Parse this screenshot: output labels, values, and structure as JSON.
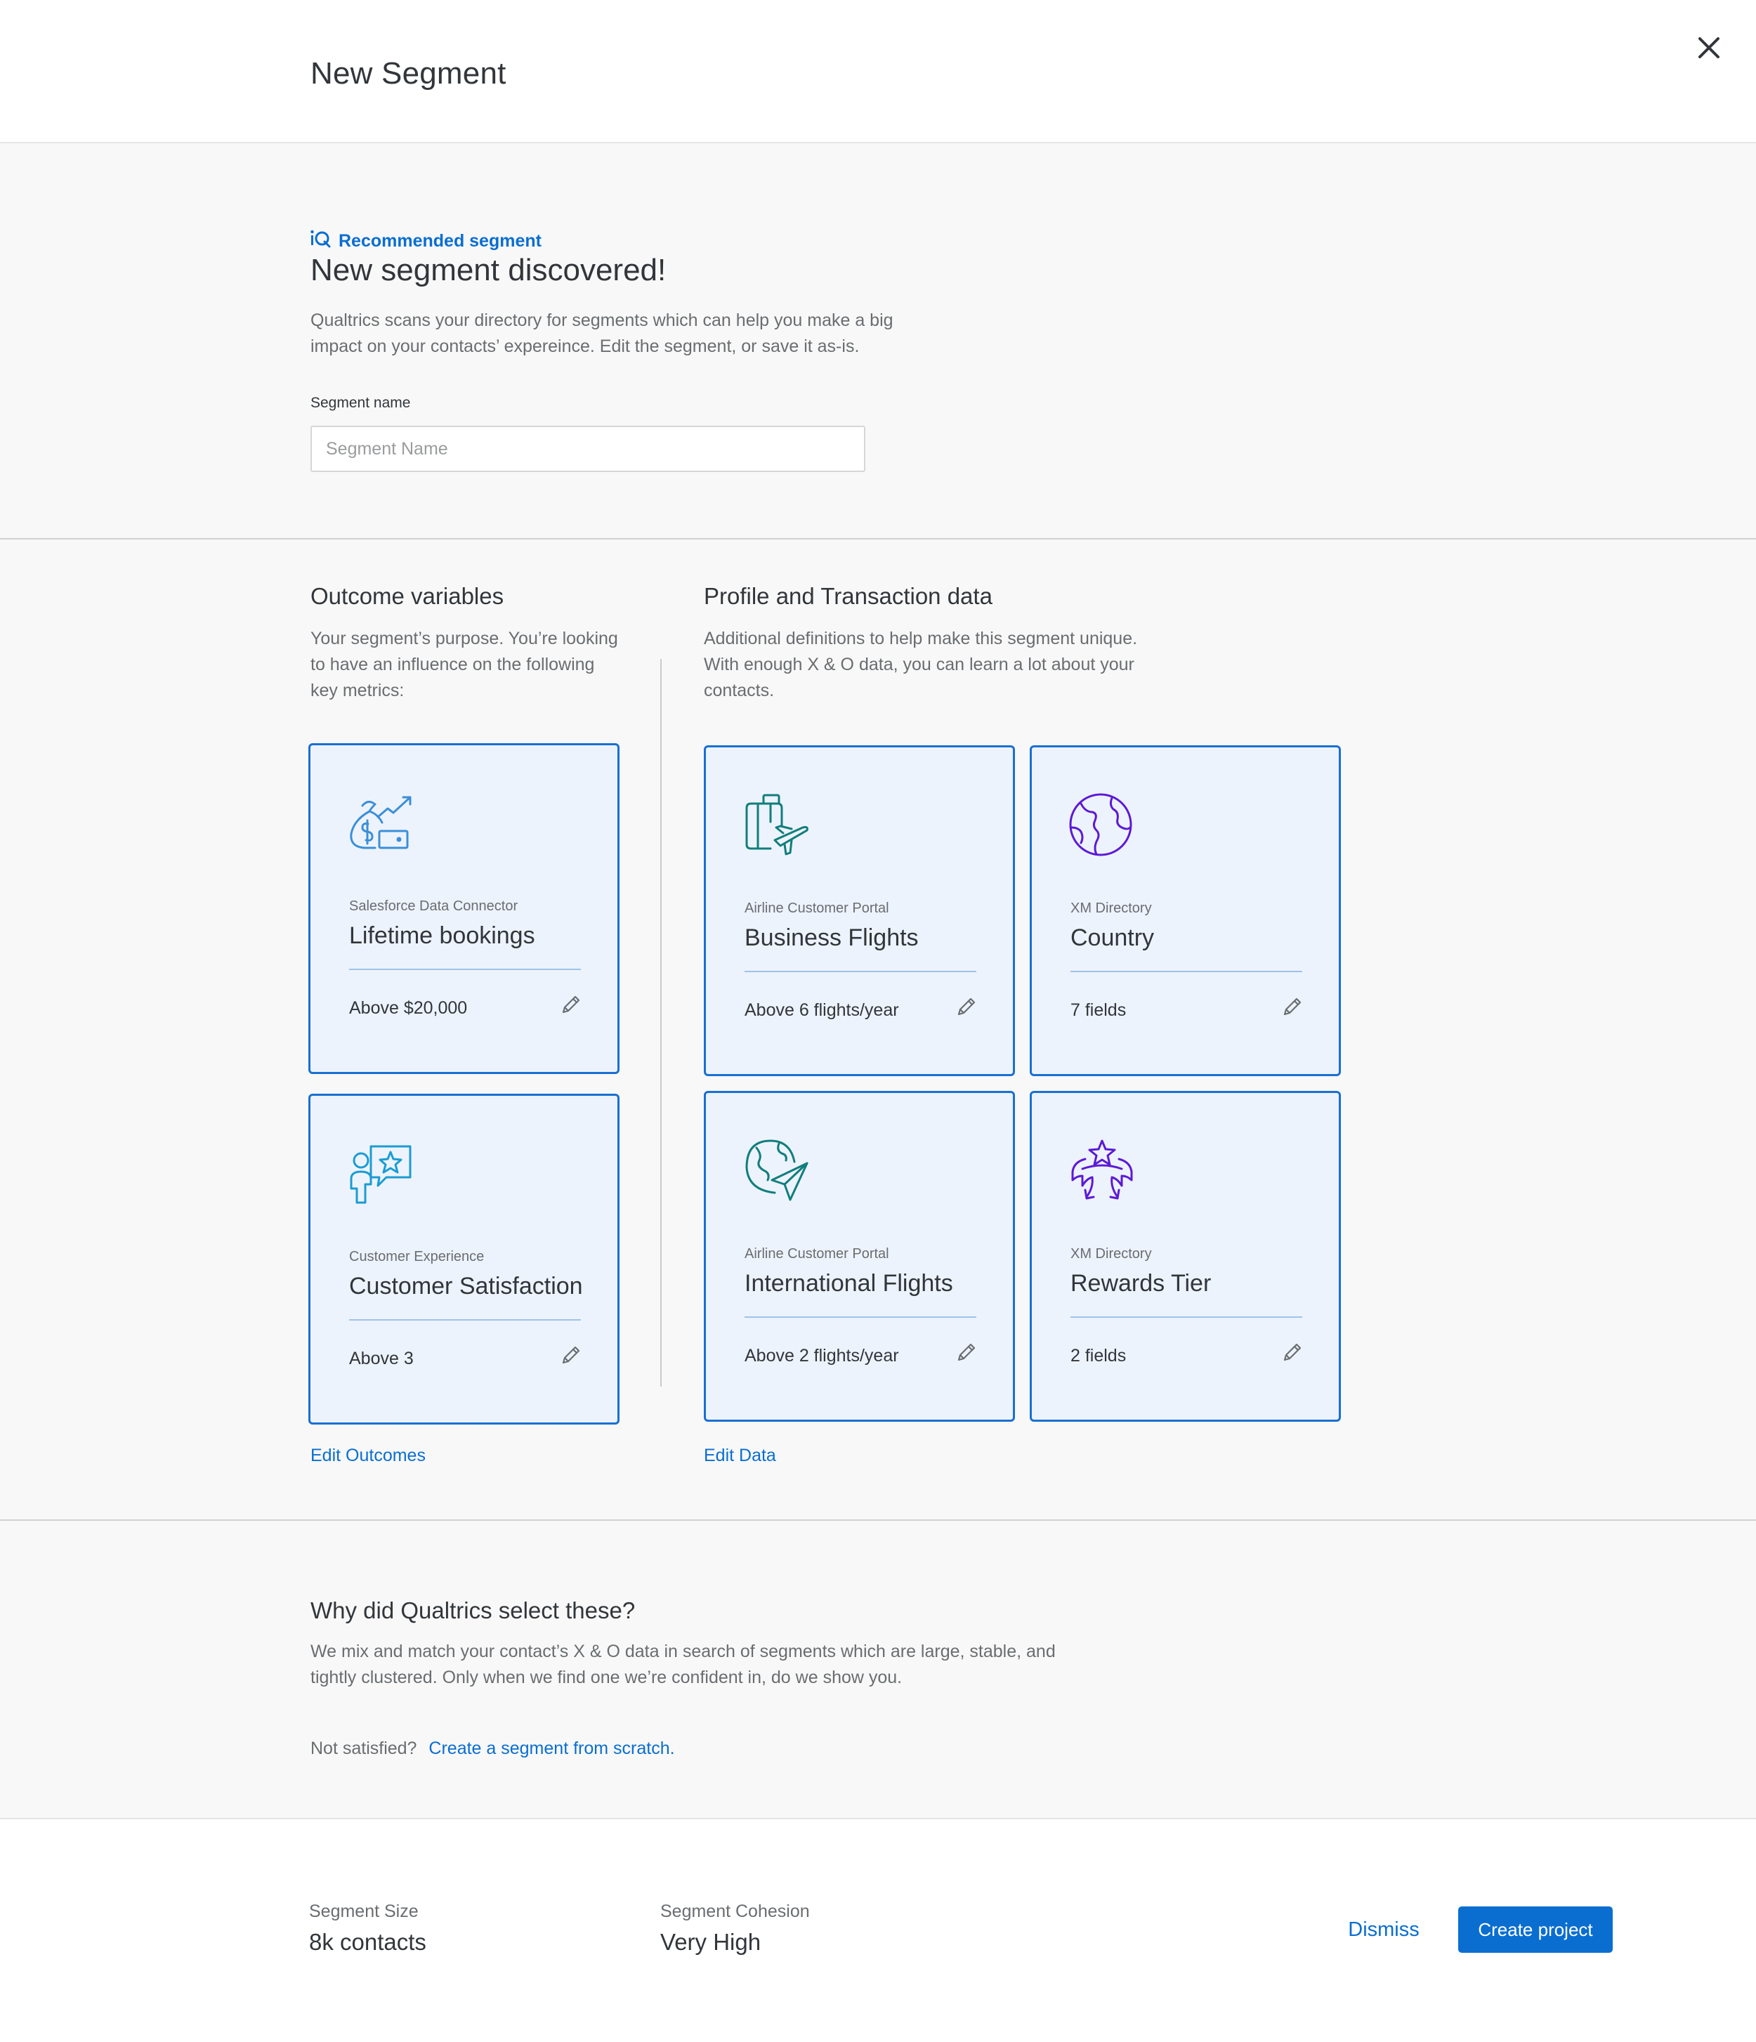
{
  "header": {
    "title": "New Segment",
    "close_icon": "close-icon"
  },
  "intro": {
    "badge_icon": "iq-icon",
    "badge_label": "Recommended segment",
    "heading": "New segment discovered!",
    "description": "Qualtrics scans your directory for segments which can help you make a big impact on your contacts’ expereince.  Edit the segment, or save it as-is.",
    "segment_name_label": "Segment name",
    "segment_name_value": "",
    "segment_name_placeholder": "Segment Name"
  },
  "outcomes": {
    "title": "Outcome variables",
    "description": "Your segment’s purpose.  You’re looking to have an influence on the following key metrics:",
    "edit_link": "Edit Outcomes",
    "cards": [
      {
        "icon": "money-bag-trend-icon",
        "source": "Salesforce Data Connector",
        "name": "Lifetime bookings",
        "condition": "Above $20,000"
      },
      {
        "icon": "person-star-chat-icon",
        "source": "Customer Experience",
        "name": "Customer Satisfaction",
        "condition": "Above 3"
      }
    ]
  },
  "profile": {
    "title": "Profile and Transaction data",
    "description": "Additional definitions to help make this segment unique.  With enough X & O data, you can learn a lot about your contacts.",
    "edit_link": "Edit Data",
    "cards": [
      {
        "icon": "luggage-plane-icon",
        "source": "Airline Customer Portal",
        "name": "Business Flights",
        "condition": "Above 6 flights/year"
      },
      {
        "icon": "globe-icon",
        "source": "XM Directory",
        "name": "Country",
        "condition": "7 fields"
      },
      {
        "icon": "globe-paper-plane-icon",
        "source": "Airline Customer Portal",
        "name": "International Flights",
        "condition": "Above 2 flights/year"
      },
      {
        "icon": "laurel-star-icon",
        "source": "XM Directory",
        "name": "Rewards Tier",
        "condition": "2 fields"
      }
    ]
  },
  "why": {
    "title": "Why did Qualtrics select these?",
    "description": "We mix and match your contact’s X & O data in search of segments which are large, stable, and tightly clustered.  Only when we find one we’re confident in, do we show you.",
    "not_satisfied": "Not satisfied?",
    "scratch_link": "Create a segment from scratch."
  },
  "footer": {
    "size_label": "Segment Size",
    "size_value": "8k contacts",
    "cohesion_label": "Segment Cohesion",
    "cohesion_value": "Very High",
    "dismiss_label": "Dismiss",
    "create_label": "Create project"
  },
  "colors": {
    "accent": "#0a6ed1",
    "card_border": "#1970d2",
    "card_bg": "#edf3fc",
    "icon_blue": "#3b8fd9",
    "icon_cyan": "#1a9cd2",
    "icon_teal": "#107e7d",
    "icon_purple": "#5d1ad6"
  }
}
